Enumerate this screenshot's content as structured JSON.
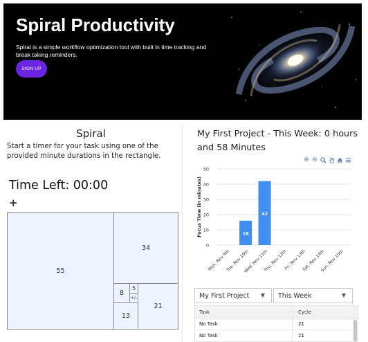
{
  "hero": {
    "title": "Spiral Productivity",
    "description": "Spiral is a simple workflow optimization tool with built in time tracking and break taking reminders.",
    "signup_label": "SIGN UP"
  },
  "timer": {
    "title": "Spiral",
    "instruction": "Start a timer for your task using one of the provided minute durations in the rectangle.",
    "time_left": "Time Left: 00:00",
    "add_symbol": "+",
    "boxes": {
      "b55": "55",
      "b34": "34",
      "b21": "21",
      "b13": "13",
      "b8": "8",
      "b5": "5",
      "bpm": "+/-"
    }
  },
  "project": {
    "title": "My First Project - This Week: 0 hours and 58 Minutes",
    "project_select": "My First Project",
    "range_select": "This Week"
  },
  "chart_data": {
    "type": "bar",
    "categories": [
      "Mon, Nov 9th",
      "Tue, Nov 10th",
      "Wed, Nov 11th",
      "Thu, Nov 12th",
      "Fri, Nov 13th",
      "Sat, Nov 14th",
      "Sun, Nov 15th"
    ],
    "values": [
      0,
      16,
      42,
      0,
      0,
      0,
      0
    ],
    "data_labels": [
      "",
      "16",
      "42",
      "",
      "",
      "",
      ""
    ],
    "ylabel": "Focus Time (in minutes)",
    "ylim": [
      0,
      50
    ],
    "yticks": [
      "0",
      "10",
      "20",
      "30",
      "40",
      "50"
    ],
    "grid": true,
    "bar_color": "#3f8ef0"
  },
  "table": {
    "headers": [
      "Task",
      "Cycle"
    ],
    "rows": [
      [
        "No Task",
        "21"
      ],
      [
        "No Task",
        "21"
      ]
    ]
  },
  "colors": {
    "accent": "#6b25e0",
    "box_fill": "#eef4fd",
    "bar": "#3f8ef0"
  }
}
